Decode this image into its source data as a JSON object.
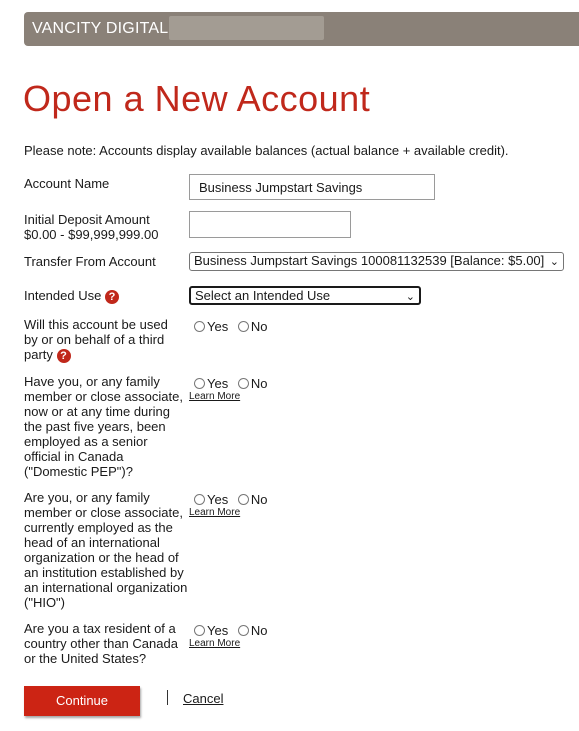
{
  "header": {
    "brand": "VANCITY DIGITAL"
  },
  "page": {
    "title": "Open a New Account",
    "note": "Please note: Accounts display available balances (actual balance + available credit)."
  },
  "form": {
    "account_name": {
      "label": "Account Name",
      "value": "Business Jumpstart Savings"
    },
    "initial_deposit": {
      "label_line1": "Initial Deposit Amount",
      "label_line2": "$0.00 - $99,999,999.00",
      "value": ""
    },
    "transfer_from": {
      "label": "Transfer From Account",
      "selected": "Business Jumpstart Savings 100081132539 [Balance: $5.00]"
    },
    "intended_use": {
      "label": "Intended Use",
      "selected": "Select an Intended Use"
    },
    "help_icon": "?",
    "third_party": {
      "label": "Will this account be used by or on behalf of a third party"
    },
    "domestic_pep": {
      "label": "Have you, or any family member or close associate, now or at any time during the past five years, been employed as a senior official in Canada (\"Domestic PEP\")?"
    },
    "hio": {
      "label": "Are you, or any family member or close associate, currently employed as the head of an international organization or the head of an institution established by an international organization (\"HIO\")"
    },
    "tax_resident": {
      "label": "Are you a tax resident of a country other than Canada or the United States?"
    },
    "yes": "Yes",
    "no": "No",
    "learn_more": "Learn More",
    "chevron": "⌄"
  },
  "actions": {
    "continue": "Continue",
    "cancel": "Cancel"
  },
  "colors": {
    "accent": "#c0281b",
    "header_bg": "#8a8178"
  }
}
